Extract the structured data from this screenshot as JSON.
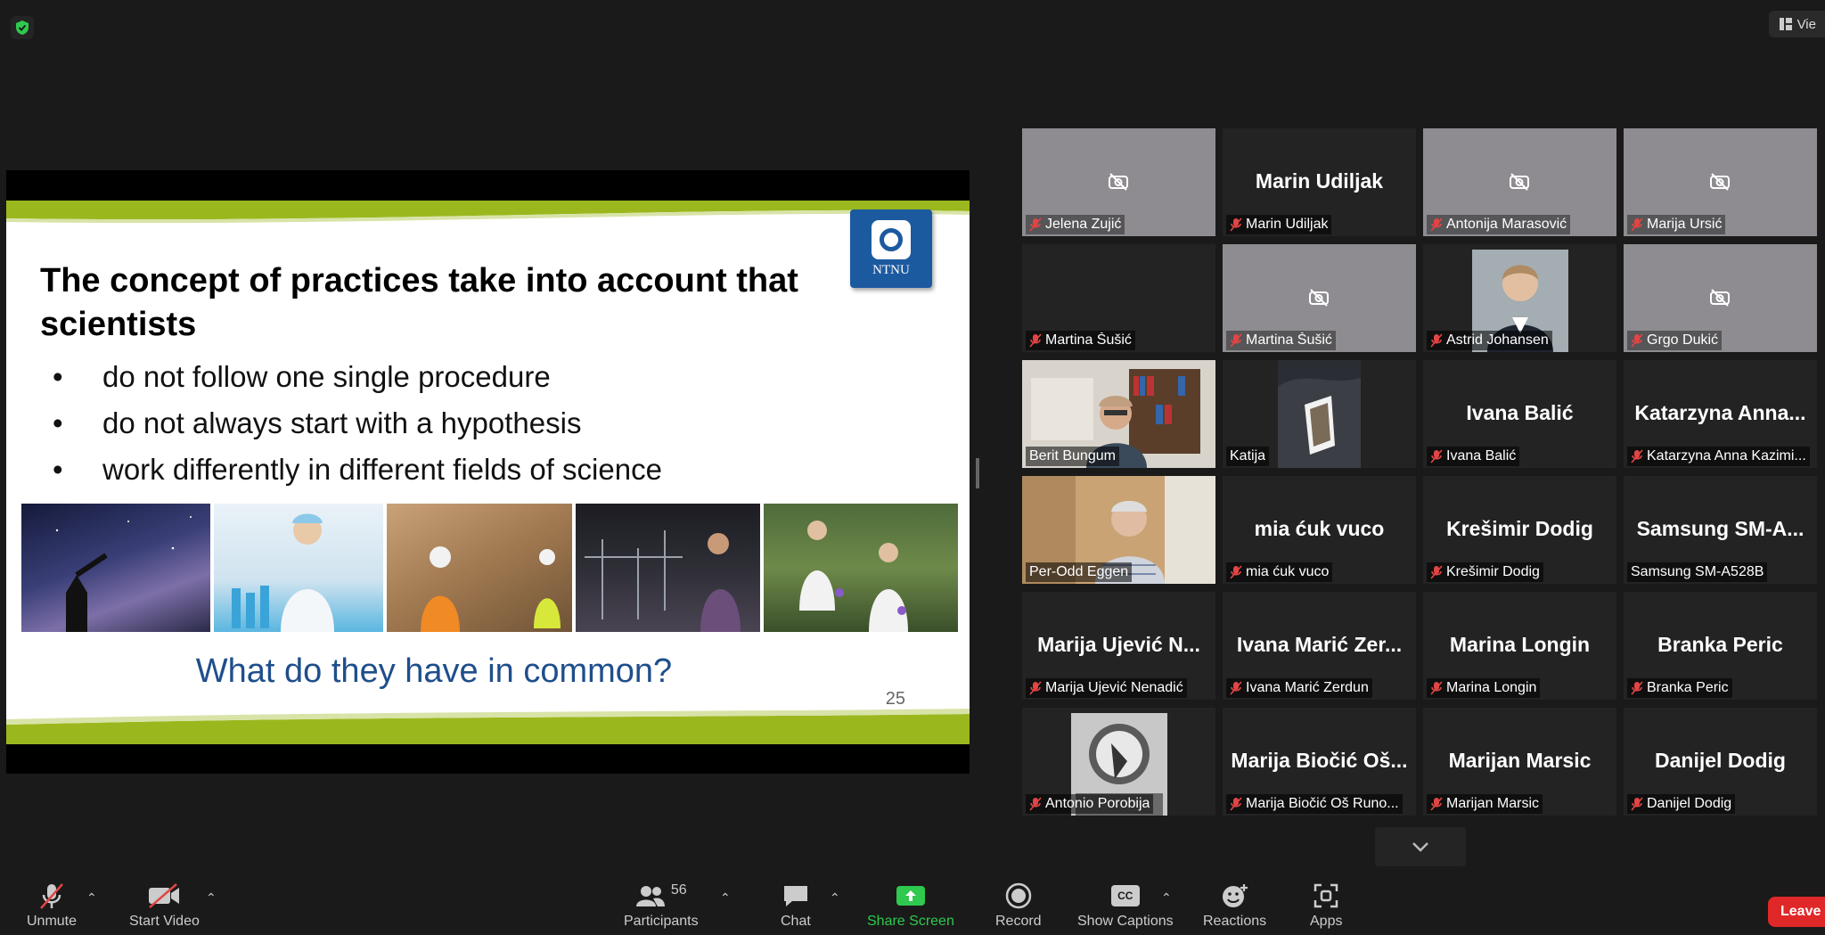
{
  "top": {
    "view_label": "Vie"
  },
  "slide": {
    "title": "The concept of practices take into account that scientists",
    "bullets": [
      "do not follow one single procedure",
      "do not always start with a hypothesis",
      "work differently in different fields of science"
    ],
    "question": "What do they have in common?",
    "page_number": "25",
    "logo_text": "NTNU",
    "accent_color": "#9ab81e",
    "question_color": "#1f4e8c"
  },
  "gallery": {
    "tiles": [
      {
        "big": "",
        "label": "Jelena Zujić"
      },
      {
        "big": "Marin Udiljak",
        "label": "Marin Udiljak"
      },
      {
        "big": "",
        "label": "Antonija Marasović"
      },
      {
        "big": "",
        "label": "Marija Ursić"
      },
      {
        "big": "",
        "label": "Martina Šušić"
      },
      {
        "big": "",
        "label": "Martina Šušić"
      },
      {
        "big": "",
        "label": "Astrid Johansen"
      },
      {
        "big": "",
        "label": "Grgo Dukić"
      },
      {
        "big": "",
        "label": "Berit Bungum"
      },
      {
        "big": "",
        "label": "Katija"
      },
      {
        "big": "Ivana Balić",
        "label": "Ivana Balić"
      },
      {
        "big": "Katarzyna Anna...",
        "label": "Katarzyna Anna Kazimi..."
      },
      {
        "big": "",
        "label": "Per-Odd Eggen"
      },
      {
        "big": "mia ćuk vuco",
        "label": "mia ćuk vuco"
      },
      {
        "big": "Krešimir Dodig",
        "label": "Krešimir Dodig"
      },
      {
        "big": "Samsung SM-A...",
        "label": "Samsung SM-A528B"
      },
      {
        "big": "Marija Ujević N...",
        "label": "Marija Ujević Nenadić"
      },
      {
        "big": "Ivana Marić Zer...",
        "label": "Ivana Marić Zerdun"
      },
      {
        "big": "Marina Longin",
        "label": "Marina Longin"
      },
      {
        "big": "Branka Peric",
        "label": "Branka Peric"
      },
      {
        "big": "",
        "label": "Antonio Porobija"
      },
      {
        "big": "Marija Biočić Oš...",
        "label": "Marija Biočić Oš Runo..."
      },
      {
        "big": "Marijan Marsic",
        "label": "Marijan Marsic"
      },
      {
        "big": "Danijel Dodig",
        "label": "Danijel Dodig"
      }
    ]
  },
  "toolbar": {
    "unmute": "Unmute",
    "start_video": "Start Video",
    "participants": "Participants",
    "participants_count": "56",
    "chat": "Chat",
    "share_screen": "Share Screen",
    "record": "Record",
    "show_captions": "Show Captions",
    "reactions": "Reactions",
    "apps": "Apps",
    "leave": "Leave",
    "share_color": "#2ec94e",
    "captions_icon_text": "CC"
  }
}
